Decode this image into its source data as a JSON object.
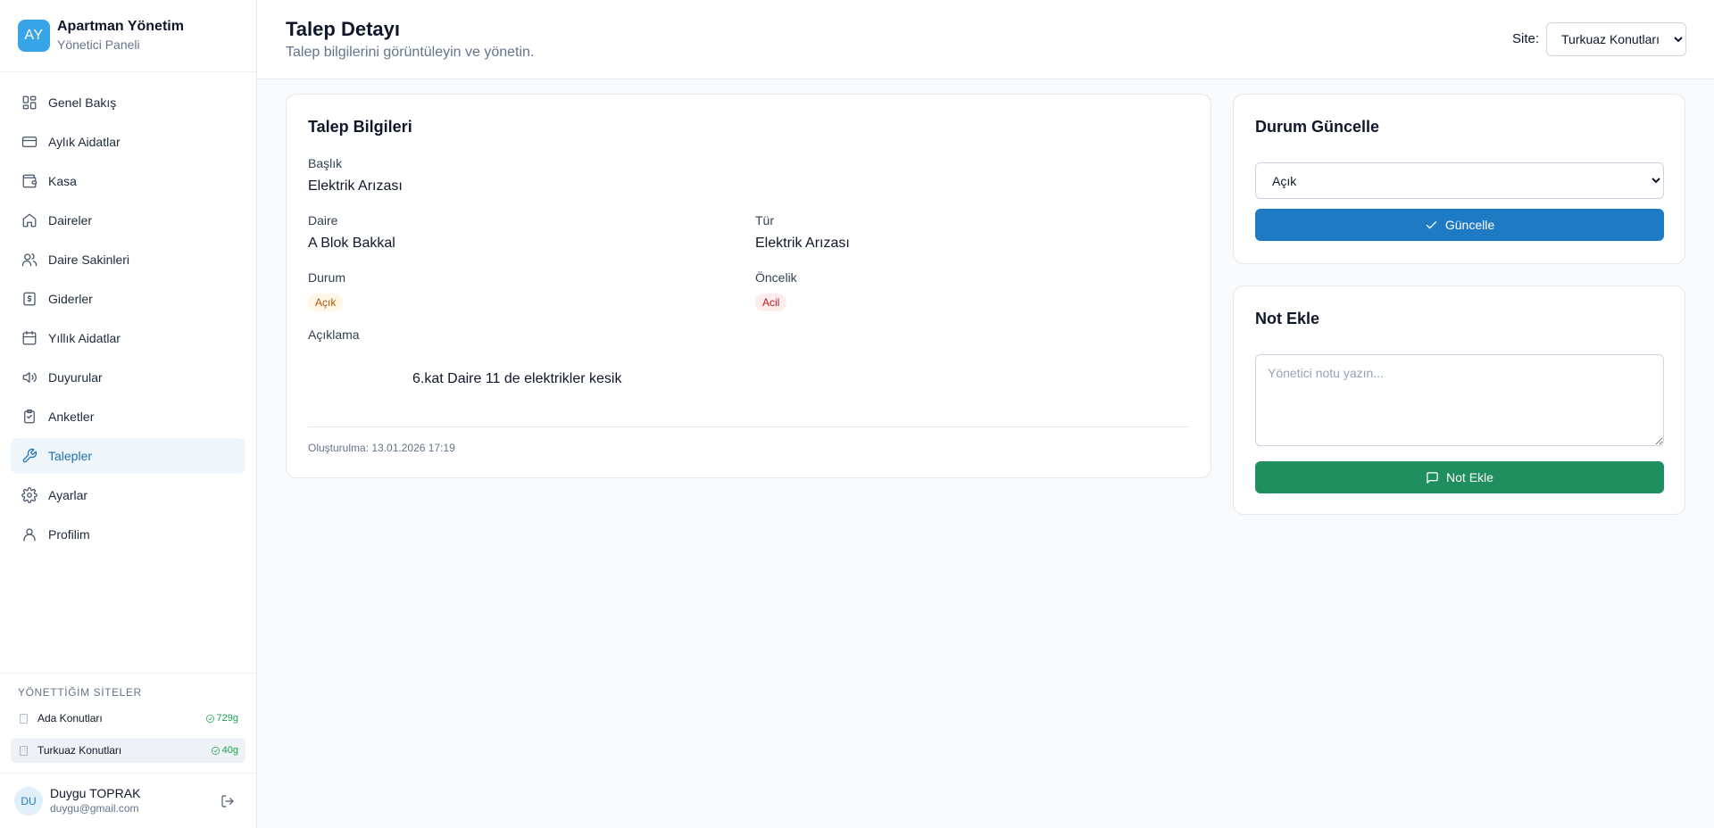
{
  "brand": {
    "logo": "AY",
    "title": "Apartman Yönetim",
    "subtitle": "Yönetici Paneli"
  },
  "nav": [
    {
      "label": "Genel Bakış",
      "icon": "dashboard-icon",
      "active": false
    },
    {
      "label": "Aylık Aidatlar",
      "icon": "credit-card-icon",
      "active": false
    },
    {
      "label": "Kasa",
      "icon": "wallet-icon",
      "active": false
    },
    {
      "label": "Daireler",
      "icon": "home-icon",
      "active": false
    },
    {
      "label": "Daire Sakinleri",
      "icon": "users-icon",
      "active": false
    },
    {
      "label": "Giderler",
      "icon": "receipt-icon",
      "active": false
    },
    {
      "label": "Yıllık Aidatlar",
      "icon": "calendar-icon",
      "active": false
    },
    {
      "label": "Duyurular",
      "icon": "megaphone-icon",
      "active": false
    },
    {
      "label": "Anketler",
      "icon": "clipboard-icon",
      "active": false
    },
    {
      "label": "Talepler",
      "icon": "wrench-icon",
      "active": true
    },
    {
      "label": "Ayarlar",
      "icon": "gear-icon",
      "active": false
    },
    {
      "label": "Profilim",
      "icon": "user-icon",
      "active": false
    }
  ],
  "sites": {
    "heading": "YÖNETTİĞİM SİTELER",
    "items": [
      {
        "name": "Ada Konutları",
        "badge": "729g",
        "active": false
      },
      {
        "name": "Turkuaz Konutları",
        "badge": "40g",
        "active": true
      }
    ]
  },
  "user": {
    "initials": "DU",
    "name": "Duygu TOPRAK",
    "email": "duygu@gmail.com"
  },
  "header": {
    "title": "Talep Detayı",
    "subtitle": "Talep bilgilerini görüntüleyin ve yönetin.",
    "site_label": "Site:",
    "site_selected": "Turkuaz Konutları"
  },
  "details": {
    "card_title": "Talep Bilgileri",
    "baslik_label": "Başlık",
    "baslik_value": "Elektrik Arızası",
    "daire_label": "Daire",
    "daire_value": "A Blok Bakkal",
    "tur_label": "Tür",
    "tur_value": "Elektrik Arızası",
    "durum_label": "Durum",
    "durum_value": "Açık",
    "oncelik_label": "Öncelik",
    "oncelik_value": "Acil",
    "aciklama_label": "Açıklama",
    "aciklama_value": "6.kat Daire 11 de elektrikler kesik",
    "created": "Oluşturulma: 13.01.2026 17:19"
  },
  "status_card": {
    "title": "Durum Güncelle",
    "selected": "Açık",
    "button": "Güncelle"
  },
  "note_card": {
    "title": "Not Ekle",
    "placeholder": "Yönetici notu yazın...",
    "button": "Not Ekle"
  },
  "colors": {
    "accent": "#1f7ac4",
    "success": "#1f8f5f",
    "brand": "#38a4e8"
  }
}
